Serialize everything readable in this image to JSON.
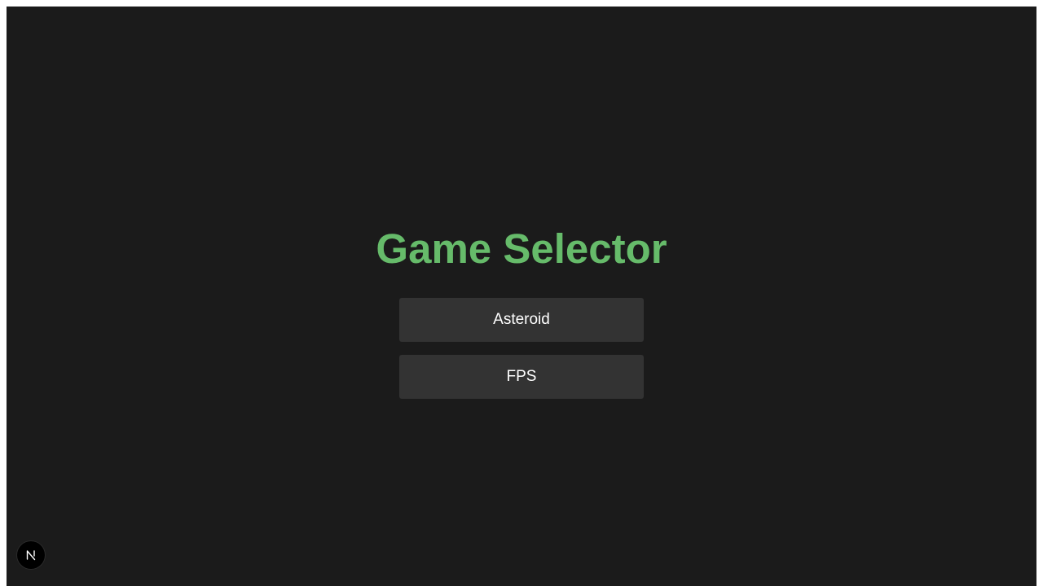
{
  "page": {
    "title": "Game Selector",
    "background_color": "#1b1b1b",
    "title_color": "#66bb6a"
  },
  "games": [
    {
      "label": "Asteroid"
    },
    {
      "label": "FPS"
    }
  ],
  "dev_badge": {
    "icon": "nextjs-logo-icon",
    "letter": "N"
  }
}
